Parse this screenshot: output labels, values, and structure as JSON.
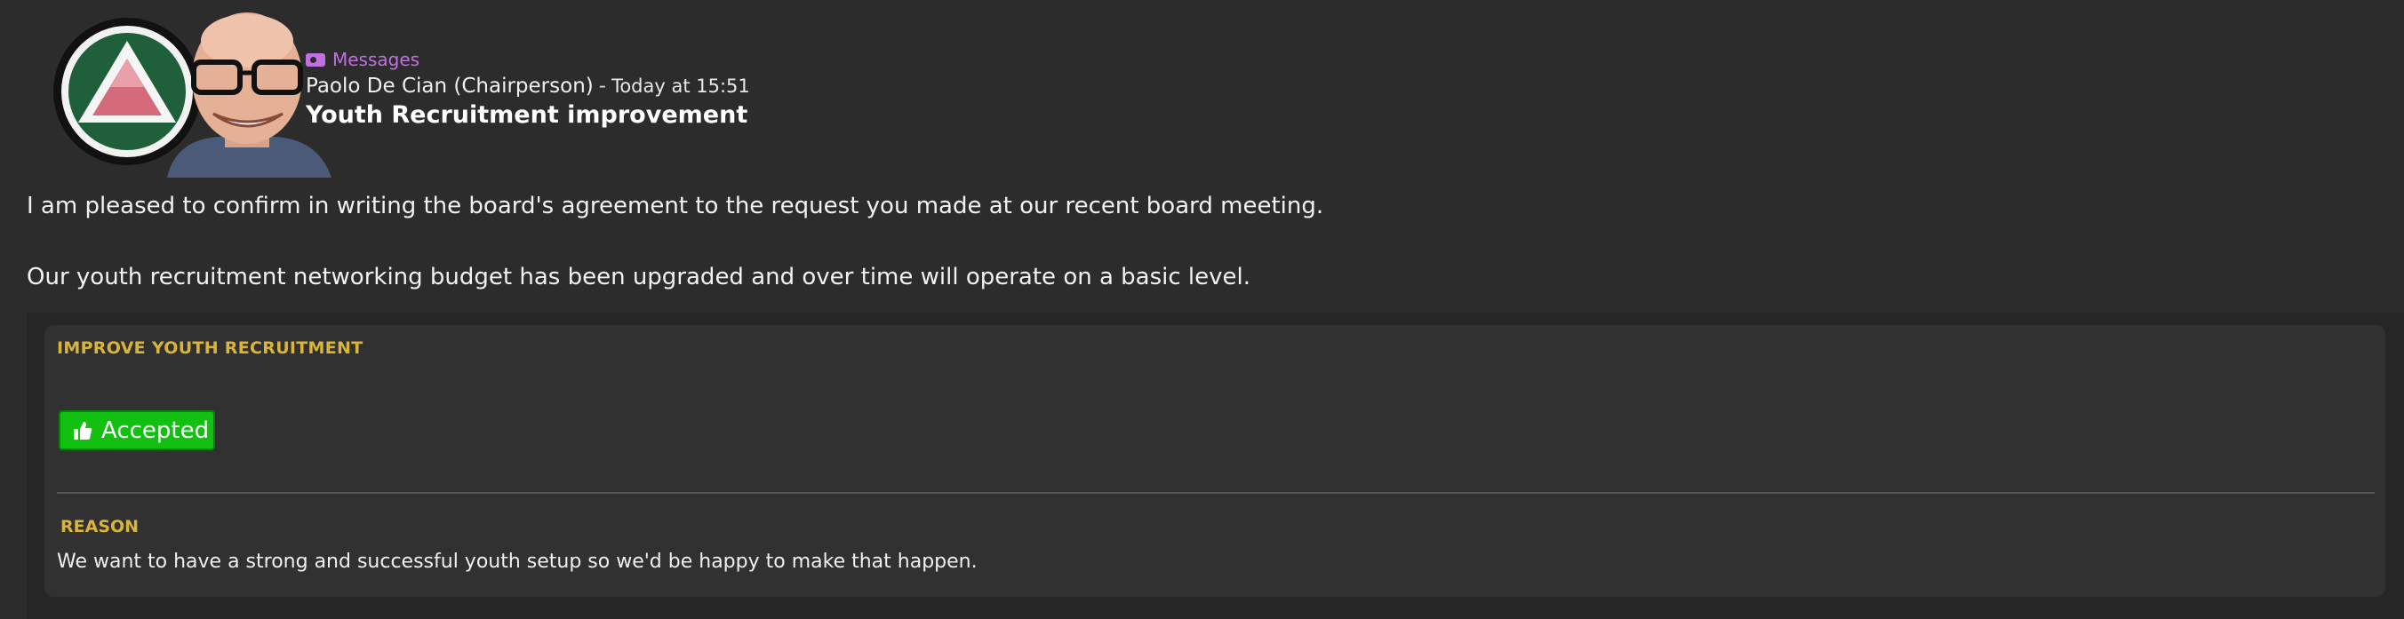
{
  "message": {
    "category": "Messages",
    "sender": "Paolo De Cian (Chairperson)",
    "separator": "-",
    "timestamp": "Today at 15:51",
    "subject": "Youth Recruitment improvement",
    "body": [
      "I am pleased to confirm in writing the board's agreement to the request you made at our recent board meeting.",
      "Our youth recruitment networking budget has been upgraded and over time will operate on a basic level."
    ]
  },
  "request_panel": {
    "title": "IMPROVE YOUTH RECRUITMENT",
    "status_label": "Accepted",
    "status_icon": "thumbs-up-icon",
    "reason_label": "REASON",
    "reason_text": "We want to have a strong and successful youth setup so we'd be happy to make that happen."
  },
  "colors": {
    "background": "#2c2c2c",
    "category_accent": "#c070e0",
    "section_heading": "#d9b43a",
    "accepted": "#11c011"
  }
}
